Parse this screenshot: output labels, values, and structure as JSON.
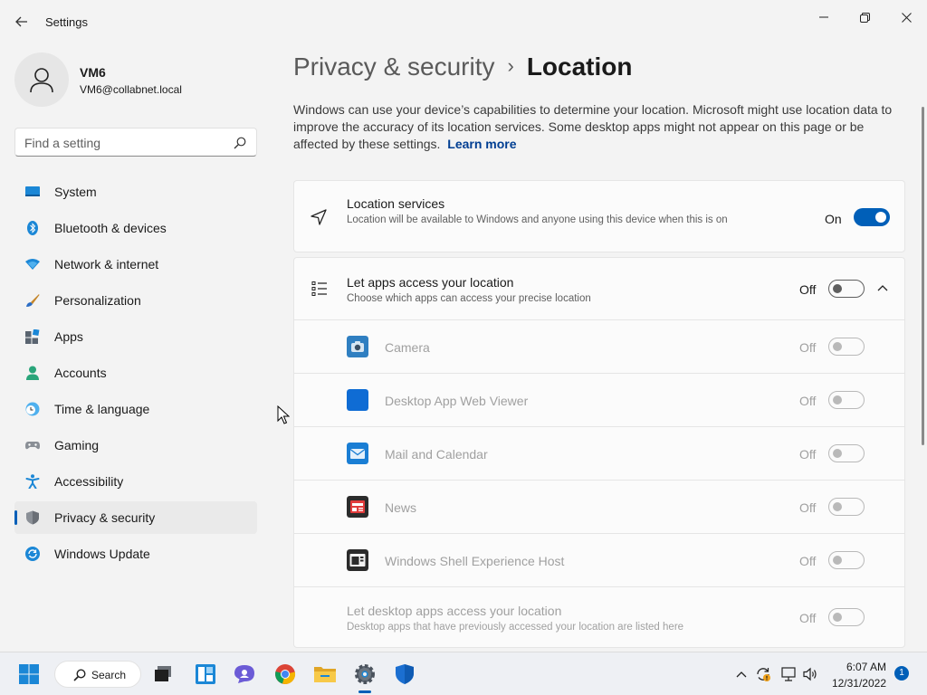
{
  "window": {
    "title": "Settings",
    "minimize_glyph": "—",
    "maximize_glyph": "❐",
    "close_glyph": "✕"
  },
  "profile": {
    "name": "VM6",
    "email": "VM6@collabnet.local"
  },
  "search": {
    "placeholder": "Find a setting"
  },
  "sidebar": {
    "items": [
      {
        "label": "System",
        "icon": "system-icon"
      },
      {
        "label": "Bluetooth & devices",
        "icon": "bluetooth-icon"
      },
      {
        "label": "Network & internet",
        "icon": "network-icon"
      },
      {
        "label": "Personalization",
        "icon": "brush-icon"
      },
      {
        "label": "Apps",
        "icon": "apps-icon"
      },
      {
        "label": "Accounts",
        "icon": "accounts-icon"
      },
      {
        "label": "Time & language",
        "icon": "clock-globe-icon"
      },
      {
        "label": "Gaming",
        "icon": "gamepad-icon"
      },
      {
        "label": "Accessibility",
        "icon": "accessibility-icon"
      },
      {
        "label": "Privacy & security",
        "icon": "shield-icon",
        "active": true
      },
      {
        "label": "Windows Update",
        "icon": "update-icon"
      }
    ]
  },
  "breadcrumb": {
    "parent": "Privacy & security",
    "separator": "›",
    "current": "Location"
  },
  "description": {
    "text": "Windows can use your device’s capabilities to determine your location. Microsoft might use location data to improve the accuracy of its location services. Some desktop apps might not appear on this page or be affected by these settings.",
    "link": "Learn more"
  },
  "location_services": {
    "title": "Location services",
    "subtitle": "Location will be available to Windows and anyone using this device when this is on",
    "state": "On",
    "toggle_on": true
  },
  "apps_access": {
    "title": "Let apps access your location",
    "subtitle": "Choose which apps can access your precise location",
    "state": "Off",
    "toggle_on": false,
    "expanded": true,
    "apps": [
      {
        "name": "Camera",
        "state": "Off",
        "icon": "camera-app-icon"
      },
      {
        "name": "Desktop App Web Viewer",
        "state": "Off",
        "icon": "web-viewer-app-icon"
      },
      {
        "name": "Mail and Calendar",
        "state": "Off",
        "icon": "mail-app-icon"
      },
      {
        "name": "News",
        "state": "Off",
        "icon": "news-app-icon"
      },
      {
        "name": "Windows Shell Experience Host",
        "state": "Off",
        "icon": "shell-host-app-icon"
      }
    ],
    "desktop_apps": {
      "title": "Let desktop apps access your location",
      "subtitle": "Desktop apps that have previously accessed your location are listed here",
      "state": "Off"
    }
  },
  "taskbar": {
    "search_label": "Search",
    "apps": [
      "start-icon",
      "task-view-icon",
      "widgets-icon",
      "teams-chat-icon",
      "chrome-icon",
      "file-explorer-icon",
      "settings-icon",
      "defender-icon"
    ],
    "clock": {
      "time": "6:07 AM",
      "date": "12/31/2022"
    },
    "notification_count": "1"
  },
  "colors": {
    "accent": "#005fb8",
    "link": "#003e92",
    "background": "#f3f3f3",
    "card": "#fbfbfb"
  }
}
